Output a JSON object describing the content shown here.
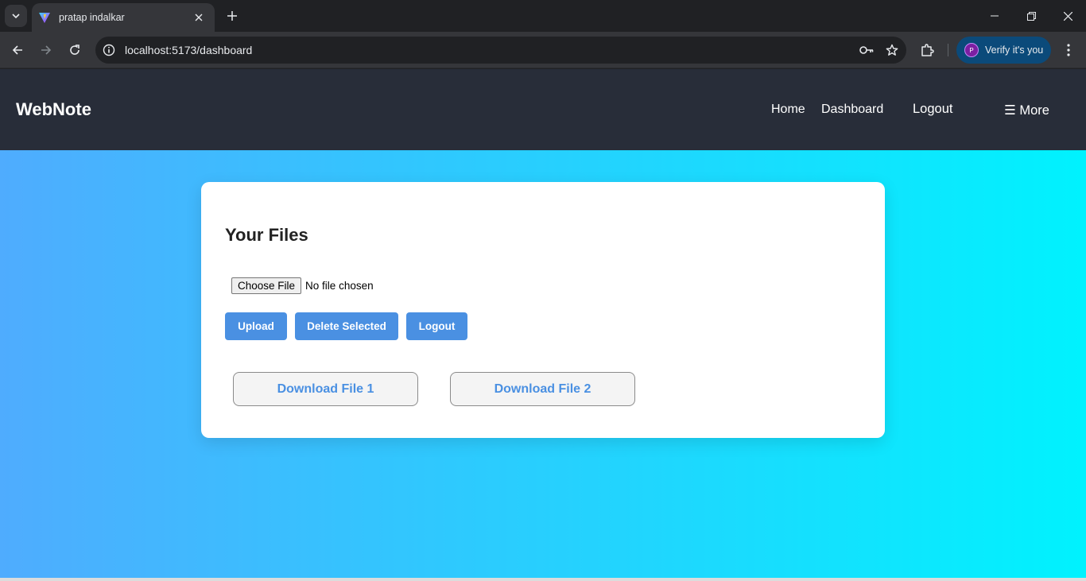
{
  "browser": {
    "tab_title": "pratap indalkar",
    "url": "localhost:5173/dashboard",
    "profile_label": "Verify it's you",
    "profile_initial": "P",
    "icons": [
      "tab-list-icon",
      "vite-favicon-icon",
      "close-icon",
      "plus-icon",
      "minimize-icon",
      "restore-icon",
      "back-icon",
      "forward-icon",
      "reload-icon",
      "site-info-icon",
      "key-icon",
      "star-icon",
      "extensions-icon",
      "more-vert-icon"
    ]
  },
  "navbar": {
    "brand": "WebNote",
    "links": [
      "Home",
      "Dashboard",
      "Logout",
      "☰ More"
    ]
  },
  "card": {
    "title": "Your Files",
    "choose_label": "Choose File",
    "file_status": "No file chosen",
    "buttons": [
      "Upload",
      "Delete Selected",
      "Logout"
    ],
    "downloads": [
      "Download File 1",
      "Download File 2"
    ]
  },
  "colors": {
    "gradient_start": "#4facfe",
    "gradient_end": "#00f2fe",
    "navbar_bg": "#282d39",
    "button_blue": "#4a90e2"
  }
}
